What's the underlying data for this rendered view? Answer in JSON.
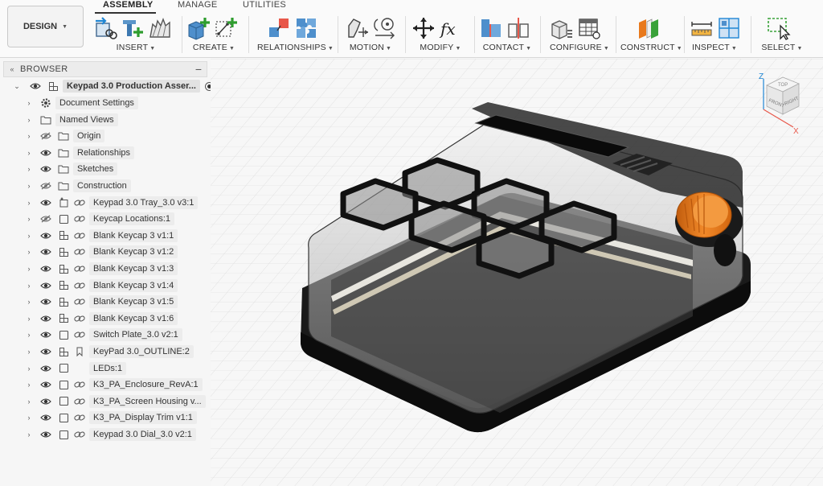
{
  "toolbar": {
    "workspace_button": "DESIGN",
    "tabs": [
      "ASSEMBLY",
      "MANAGE",
      "UTILITIES"
    ],
    "groups": [
      "INSERT",
      "CREATE",
      "RELATIONSHIPS",
      "MOTION",
      "MODIFY",
      "CONTACT",
      "CONFIGURE",
      "CONSTRUCT",
      "INSPECT",
      "SELECT"
    ]
  },
  "browser": {
    "title": "BROWSER",
    "root": "Keypad 3.0 Production Asser...",
    "items": [
      {
        "label": "Document Settings",
        "icon": "gear-icon"
      },
      {
        "label": "Named Views",
        "icon": "folder-icon"
      },
      {
        "label": "Origin",
        "icon": "folder-icon",
        "visibility": "hidden"
      },
      {
        "label": "Relationships",
        "icon": "folder-icon",
        "visibility": "visible"
      },
      {
        "label": "Sketches",
        "icon": "folder-icon",
        "visibility": "visible"
      },
      {
        "label": "Construction",
        "icon": "folder-icon",
        "visibility": "hidden"
      },
      {
        "label": "Keypad 3.0 Tray_3.0 v3:1",
        "icon": "grounded-component-icon",
        "visibility": "visible",
        "linked": true
      },
      {
        "label": "Keycap Locations:1",
        "icon": "component-icon",
        "visibility": "hidden",
        "linked": true
      },
      {
        "label": "Blank Keycap 3 v1:1",
        "icon": "assembly-icon",
        "visibility": "visible",
        "linked": true
      },
      {
        "label": "Blank Keycap 3 v1:2",
        "icon": "assembly-icon",
        "visibility": "visible",
        "linked": true
      },
      {
        "label": "Blank Keycap 3 v1:3",
        "icon": "assembly-icon",
        "visibility": "visible",
        "linked": true
      },
      {
        "label": "Blank Keycap 3 v1:4",
        "icon": "assembly-icon",
        "visibility": "visible",
        "linked": true
      },
      {
        "label": "Blank Keycap 3 v1:5",
        "icon": "assembly-icon",
        "visibility": "visible",
        "linked": true
      },
      {
        "label": "Blank Keycap 3 v1:6",
        "icon": "assembly-icon",
        "visibility": "visible",
        "linked": true
      },
      {
        "label": "Switch Plate_3.0 v2:1",
        "icon": "component-icon",
        "visibility": "visible",
        "linked": true
      },
      {
        "label": "KeyPad 3.0_OUTLINE:2",
        "icon": "assembly-icon",
        "visibility": "visible",
        "linked": false,
        "bookmark": true
      },
      {
        "label": "LEDs:1",
        "icon": "component-icon",
        "visibility": "visible",
        "linked": false
      },
      {
        "label": "K3_PA_Enclosure_RevA:1",
        "icon": "component-icon",
        "visibility": "visible",
        "linked": true
      },
      {
        "label": "K3_PA_Screen Housing v...",
        "icon": "component-icon",
        "visibility": "visible",
        "linked": true
      },
      {
        "label": "K3_PA_Display Trim v1:1",
        "icon": "component-icon",
        "visibility": "visible",
        "linked": true
      },
      {
        "label": "Keypad 3.0 Dial_3.0 v2:1",
        "icon": "component-icon",
        "visibility": "visible",
        "linked": true
      }
    ]
  },
  "viewcube": {
    "top": "TOP",
    "front": "FRONT",
    "right": "RIGHT",
    "axis_x": "X",
    "axis_z": "Z"
  },
  "colors": {
    "accent_blue": "#1f86d4",
    "accent_green": "#3aa23a",
    "dial_orange": "#e8791c",
    "enclosure_dark": "#1c1c1c"
  }
}
